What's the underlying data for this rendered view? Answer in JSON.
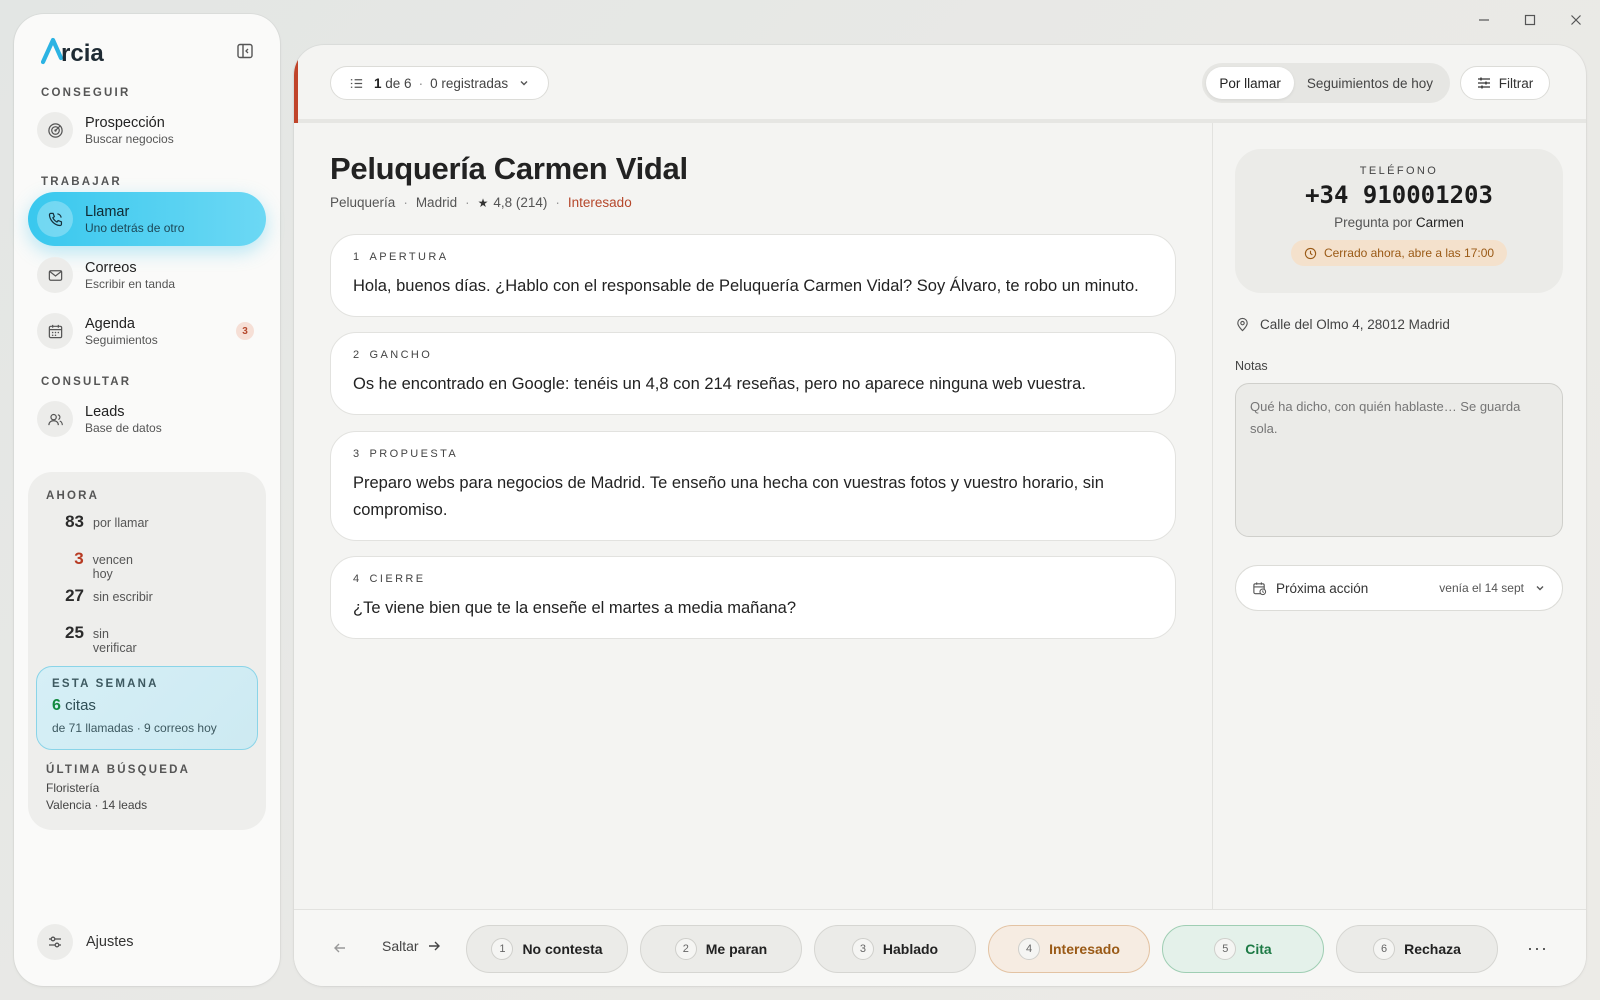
{
  "window": {
    "minimize_icon": "minimize-icon",
    "maximize_icon": "maximize-icon",
    "close_icon": "close-icon"
  },
  "sidebar": {
    "logo_text": "Arcia",
    "sections": {
      "conseguir": "CONSEGUIR",
      "trabajar": "TRABAJAR",
      "consultar": "CONSULTAR"
    },
    "items": [
      {
        "title": "Prospección",
        "subtitle": "Buscar negocios",
        "icon": "radar-icon"
      },
      {
        "title": "Llamar",
        "subtitle": "Uno detrás de otro",
        "icon": "phone-icon",
        "active": true
      },
      {
        "title": "Correos",
        "subtitle": "Escribir en tanda",
        "icon": "mail-icon"
      },
      {
        "title": "Agenda",
        "subtitle": "Seguimientos",
        "icon": "calendar-icon",
        "badge": "3"
      },
      {
        "title": "Leads",
        "subtitle": "Base de datos",
        "icon": "users-icon"
      }
    ],
    "now": {
      "label": "AHORA",
      "stats": [
        {
          "num": "83",
          "label": "por llamar"
        },
        {
          "num": "3",
          "label": "vencen hoy"
        },
        {
          "num": "27",
          "label": "sin escribir"
        },
        {
          "num": "25",
          "label": "sin verificar"
        }
      ],
      "week": {
        "label": "ESTA SEMANA",
        "count": "6",
        "unit": "citas",
        "detail": "de 71 llamadas · 9 correos hoy"
      },
      "last_search": {
        "label": "ÚLTIMA BÚSQUEDA",
        "query": "Floristería",
        "detail": "Valencia · 14 leads"
      }
    },
    "settings_label": "Ajustes"
  },
  "topbar": {
    "counter_current": "1",
    "counter_rest": "de 6",
    "registered": "0 registradas",
    "tabs": [
      "Por llamar",
      "Seguimientos de hoy"
    ],
    "filter_label": "Filtrar"
  },
  "business": {
    "name": "Peluquería Carmen Vidal",
    "category": "Peluquería",
    "city": "Madrid",
    "rating": "4,8",
    "reviews": "(214)",
    "status": "Interesado"
  },
  "script": [
    {
      "n": "1",
      "label": "APERTURA",
      "text": "Hola, buenos días. ¿Hablo con el responsable de Peluquería Carmen Vidal? Soy Álvaro, te robo un minuto."
    },
    {
      "n": "2",
      "label": "GANCHO",
      "text": "Os he encontrado en Google: tenéis un 4,8 con 214 reseñas, pero no aparece ninguna web vuestra."
    },
    {
      "n": "3",
      "label": "PROPUESTA",
      "text": "Preparo webs para negocios de Madrid. Te enseño una hecha con vuestras fotos y vuestro horario, sin compromiso."
    },
    {
      "n": "4",
      "label": "CIERRE",
      "text": "¿Te viene bien que te la enseñe el martes a media mañana?"
    }
  ],
  "contact": {
    "phone_label": "TELÉFONO",
    "phone": "+34 910001203",
    "ask_for_prefix": "Pregunta por",
    "ask_for_name": "Carmen",
    "closed_notice": "Cerrado ahora, abre a las 17:00",
    "address": "Calle del Olmo 4, 28012 Madrid",
    "notes_label": "Notas",
    "notes_placeholder": "Qué ha dicho, con quién hablaste… Se guarda sola.",
    "next_action_label": "Próxima acción",
    "next_action_value": "venía el 14 sept"
  },
  "bottom": {
    "skip_label": "Saltar",
    "outcomes": [
      {
        "k": "1",
        "label": "No contesta"
      },
      {
        "k": "2",
        "label": "Me paran"
      },
      {
        "k": "3",
        "label": "Hablado"
      },
      {
        "k": "4",
        "label": "Interesado"
      },
      {
        "k": "5",
        "label": "Cita"
      },
      {
        "k": "6",
        "label": "Rechaza"
      }
    ],
    "more_label": "···"
  },
  "colors": {
    "accent": "#39c8ee",
    "danger": "#c0442a",
    "success": "#1d7a45",
    "warm": "#9a5a16"
  }
}
